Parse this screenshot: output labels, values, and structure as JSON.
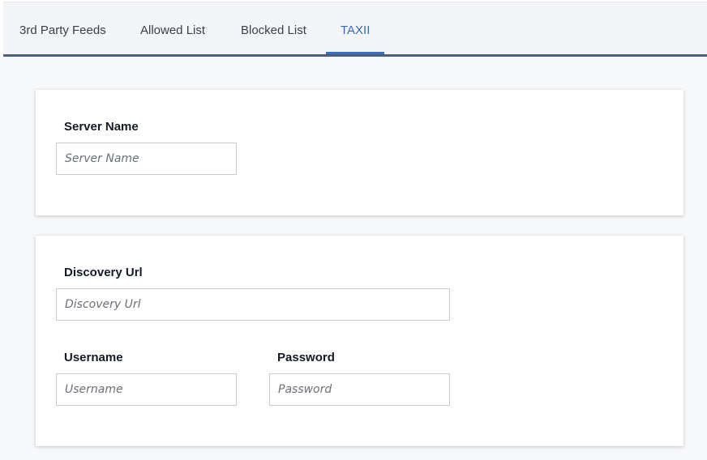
{
  "tabs": [
    {
      "label": "3rd Party Feeds"
    },
    {
      "label": "Allowed List"
    },
    {
      "label": "Blocked List"
    },
    {
      "label": "TAXII"
    }
  ],
  "server_section": {
    "server_name_label": "Server Name",
    "server_name_placeholder": "Server Name",
    "server_name_value": ""
  },
  "connection_section": {
    "discovery_url_label": "Discovery Url",
    "discovery_url_placeholder": "Discovery Url",
    "discovery_url_value": "",
    "username_label": "Username",
    "username_placeholder": "Username",
    "username_value": "",
    "password_label": "Password",
    "password_placeholder": "Password",
    "password_value": ""
  },
  "colors": {
    "active_tab": "#3a6ab0",
    "tabbar_border": "#4a607c"
  }
}
